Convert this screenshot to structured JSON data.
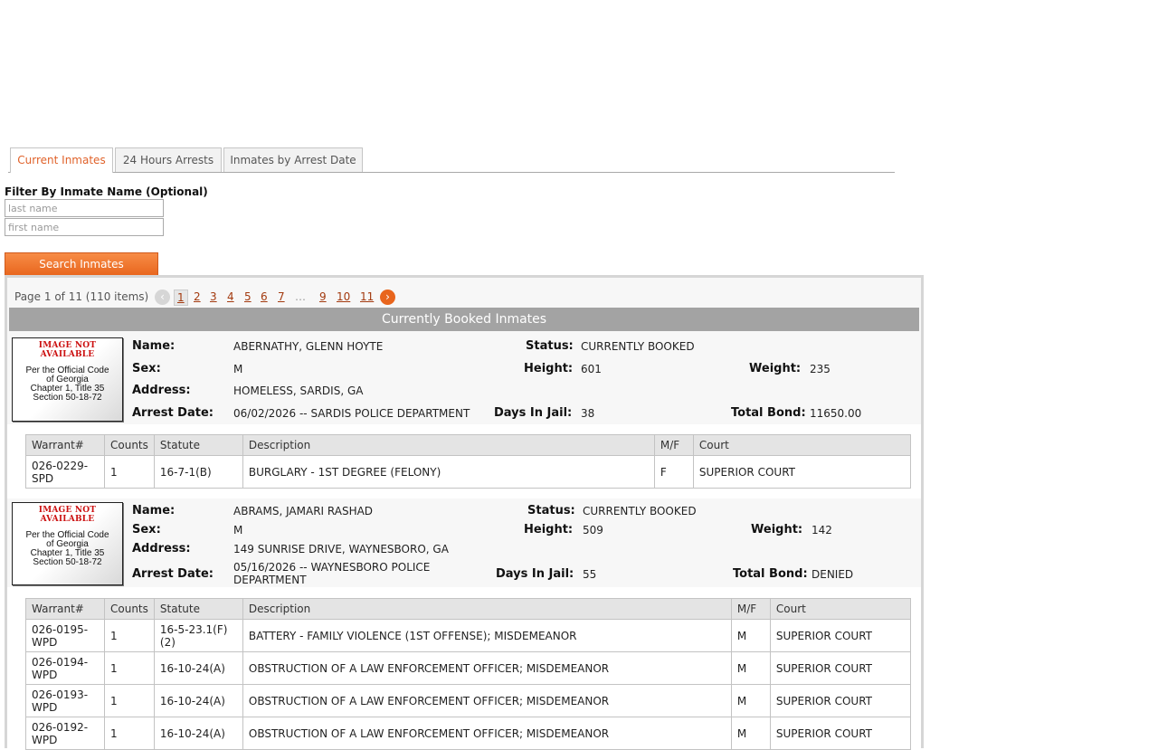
{
  "tabs": [
    {
      "label": "Current Inmates",
      "active": true
    },
    {
      "label": "24 Hours Arrests",
      "active": false
    },
    {
      "label": "Inmates by Arrest Date",
      "active": false
    }
  ],
  "filter": {
    "label": "Filter By Inmate Name (Optional)",
    "last_placeholder": "last name",
    "first_placeholder": "first name",
    "search_label": "Search Inmates"
  },
  "pager": {
    "info": "Page 1 of 11 (110 items)",
    "prev": "‹",
    "next": "›",
    "pages": [
      "1",
      "2",
      "3",
      "4",
      "5",
      "6",
      "7",
      "…",
      "9",
      "10",
      "11"
    ],
    "current": "1"
  },
  "banner": "Currently Booked Inmates",
  "labels": {
    "name": "Name:",
    "sex": "Sex:",
    "address": "Address:",
    "arrest_date": "Arrest Date:",
    "status": "Status:",
    "height": "Height:",
    "weight": "Weight:",
    "days": "Days In Jail:",
    "bond": "Total Bond:"
  },
  "photo": {
    "not_available": "IMAGE NOT AVAILABLE",
    "code_lines": [
      "Per the Official Code",
      "of Georgia",
      "Chapter 1, Title 35",
      "Section 50-18-72"
    ]
  },
  "charge_headers": [
    "Warrant#",
    "Counts",
    "Statute",
    "Description",
    "M/F",
    "Court"
  ],
  "inmates": [
    {
      "name": "ABERNATHY, GLENN HOYTE",
      "sex": "M",
      "address": "HOMELESS, SARDIS, GA",
      "arrest_date": "06/02/2026 -- SARDIS POLICE DEPARTMENT",
      "status": "CURRENTLY BOOKED",
      "height": "601",
      "weight": "235",
      "days": "38",
      "bond": "11650.00",
      "charges": [
        {
          "warrant": "026-0229-SPD",
          "counts": "1",
          "statute": "16-7-1(B)",
          "description": "BURGLARY - 1ST DEGREE (FELONY)",
          "mf": "F",
          "court": "SUPERIOR COURT"
        }
      ]
    },
    {
      "name": "ABRAMS, JAMARI RASHAD",
      "sex": "M",
      "address": "149 SUNRISE DRIVE, WAYNESBORO, GA",
      "arrest_date": "05/16/2026 -- WAYNESBORO POLICE DEPARTMENT",
      "status": "CURRENTLY BOOKED",
      "height": "509",
      "weight": "142",
      "days": "55",
      "bond": "DENIED",
      "charges": [
        {
          "warrant": "026-0195-WPD",
          "counts": "1",
          "statute": "16-5-23.1(F)(2)",
          "description": "BATTERY - FAMILY VIOLENCE (1ST OFFENSE); MISDEMEANOR",
          "mf": "M",
          "court": "SUPERIOR COURT"
        },
        {
          "warrant": "026-0194-WPD",
          "counts": "1",
          "statute": "16-10-24(A)",
          "description": "OBSTRUCTION OF A LAW ENFORCEMENT OFFICER; MISDEMEANOR",
          "mf": "M",
          "court": "SUPERIOR COURT"
        },
        {
          "warrant": "026-0193-WPD",
          "counts": "1",
          "statute": "16-10-24(A)",
          "description": "OBSTRUCTION OF A LAW ENFORCEMENT OFFICER; MISDEMEANOR",
          "mf": "M",
          "court": "SUPERIOR COURT"
        },
        {
          "warrant": "026-0192-WPD",
          "counts": "1",
          "statute": "16-10-24(A)",
          "description": "OBSTRUCTION OF A LAW ENFORCEMENT OFFICER; MISDEMEANOR",
          "mf": "M",
          "court": "SUPERIOR COURT"
        }
      ]
    }
  ]
}
